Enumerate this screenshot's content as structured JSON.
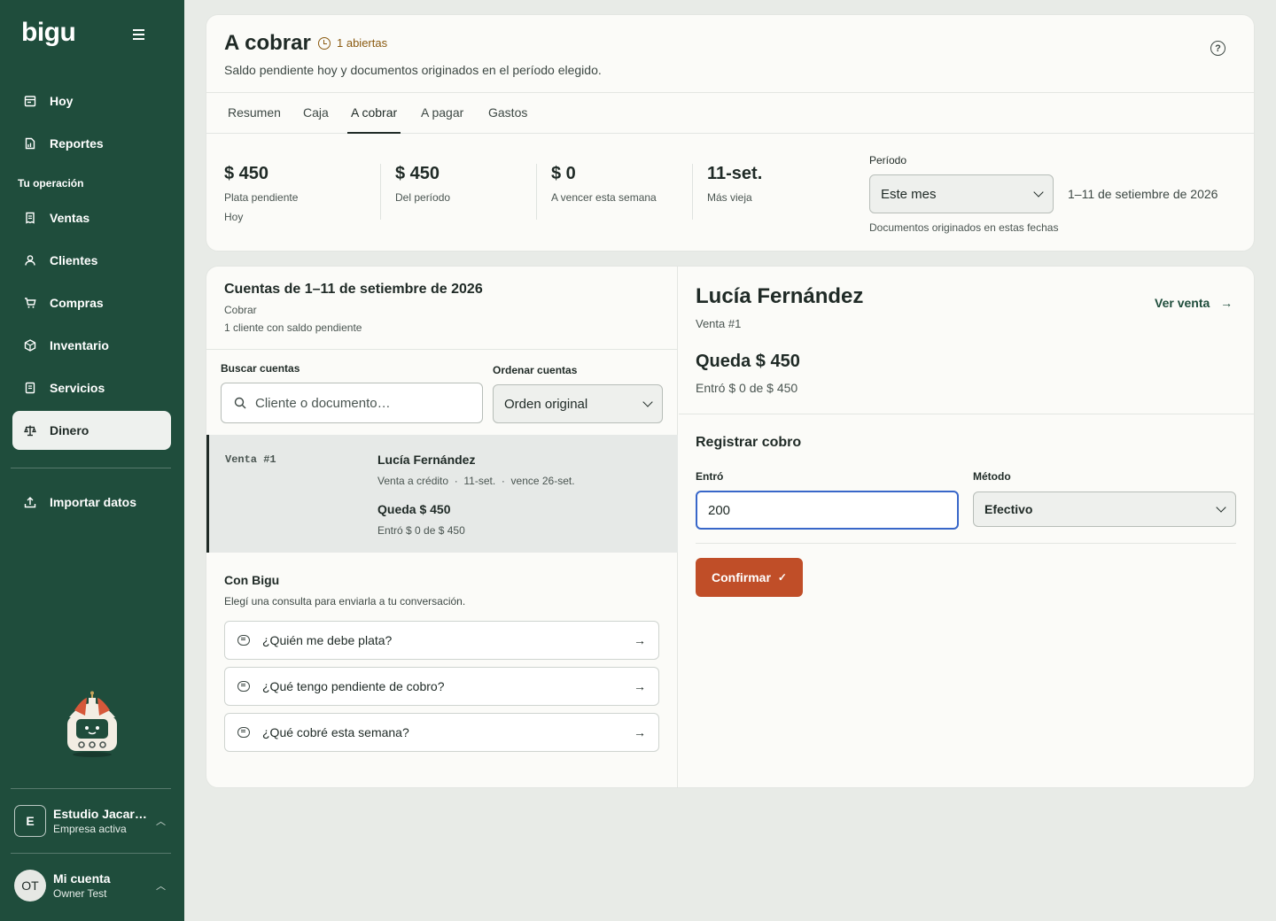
{
  "app": {
    "logo": "bigu"
  },
  "sidebar": {
    "items": [
      {
        "label": "Hoy",
        "icon": "calendar-icon"
      },
      {
        "label": "Reportes",
        "icon": "report-icon"
      },
      {
        "label": "Ventas",
        "icon": "receipt-icon"
      },
      {
        "label": "Clientes",
        "icon": "user-icon"
      },
      {
        "label": "Compras",
        "icon": "cart-icon"
      },
      {
        "label": "Inventario",
        "icon": "box-icon"
      },
      {
        "label": "Servicios",
        "icon": "document-icon"
      },
      {
        "label": "Dinero",
        "icon": "scale-icon",
        "active": true
      },
      {
        "label": "Importar datos",
        "icon": "upload-icon"
      }
    ],
    "section_label": "Tu operación",
    "company": {
      "initial": "E",
      "name": "Estudio Jacaranda",
      "status": "Empresa activa"
    },
    "account": {
      "initials": "OT",
      "name": "Mi cuenta",
      "user": "Owner Test"
    }
  },
  "header": {
    "title": "A cobrar",
    "open_badge": "1 abiertas",
    "subtitle": "Saldo pendiente hoy y documentos originados en el período elegido.",
    "tabs": [
      "Resumen",
      "Caja",
      "A cobrar",
      "A pagar",
      "Gastos"
    ],
    "active_tab": "A cobrar"
  },
  "kpis": [
    {
      "value": "$ 450",
      "label": "Plata pendiente",
      "sub": "Hoy"
    },
    {
      "value": "$ 450",
      "label": "Del período"
    },
    {
      "value": "$ 0",
      "label": "A vencer esta semana"
    },
    {
      "value": "11-set.",
      "label": "Más vieja"
    }
  ],
  "period": {
    "label": "Período",
    "selected": "Este mes",
    "range": "1–11 de setiembre de 2026",
    "hint": "Documentos originados en estas fechas"
  },
  "accounts_panel": {
    "title": "Cuentas de 1–11 de setiembre de 2026",
    "subtitle": "Cobrar",
    "count": "1 cliente con saldo pendiente",
    "search_label": "Buscar cuentas",
    "search_placeholder": "Cliente o documento…",
    "sort_label": "Ordenar cuentas",
    "sort_selected": "Orden original",
    "rows": [
      {
        "doc": "Venta #1",
        "client": "Lucía Fernández",
        "meta": "Venta a crédito  ·  11-set.  ·  vence 26-set.",
        "remaining": "Queda $ 450",
        "paid": "Entró $ 0 de $ 450"
      }
    ]
  },
  "con_bigu": {
    "title": "Con Bigu",
    "subtitle": "Elegí una consulta para enviarla a tu conversación.",
    "prompts": [
      "¿Quién me debe plata?",
      "¿Qué tengo pendiente de cobro?",
      "¿Qué cobré esta semana?"
    ]
  },
  "detail": {
    "client": "Lucía Fernández",
    "doc": "Venta #1",
    "link": "Ver venta",
    "remaining": "Queda $ 450",
    "paid": "Entró $ 0 de $ 450",
    "section": "Registrar cobro",
    "amount_label": "Entró",
    "amount_value": "200",
    "method_label": "Método",
    "method_value": "Efectivo",
    "confirm": "Confirmar"
  },
  "colors": {
    "sidebar": "#1f4d3c",
    "accent": "#c04e28",
    "focus": "#3867c9",
    "badge": "#8a5a10"
  }
}
